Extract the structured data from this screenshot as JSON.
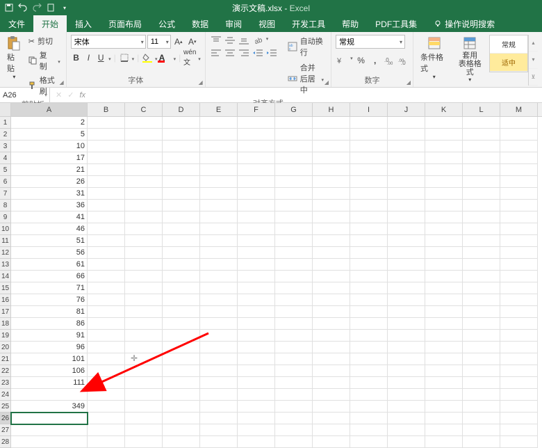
{
  "title": {
    "doc": "演示文稿.xlsx",
    "sep": " - ",
    "app": "Excel"
  },
  "tabs": [
    "文件",
    "开始",
    "插入",
    "页面布局",
    "公式",
    "数据",
    "审阅",
    "视图",
    "开发工具",
    "帮助",
    "PDF工具集"
  ],
  "active_tab": 1,
  "tell_me": "操作说明搜索",
  "clipboard": {
    "paste": "粘贴",
    "cut": "剪切",
    "copy": "复制",
    "format_painter": "格式刷",
    "label": "剪贴板"
  },
  "font": {
    "name": "宋体",
    "size": "11",
    "label": "字体",
    "bold": "B",
    "italic": "I",
    "underline": "U"
  },
  "align": {
    "wrap": "自动换行",
    "merge": "合并后居中",
    "label": "对齐方式"
  },
  "number": {
    "format": "常规",
    "label": "数字"
  },
  "styles": {
    "cond": "条件格式",
    "table": "套用\n表格格式",
    "normal": "常规",
    "good": "适中"
  },
  "namebox": "A26",
  "chart_data": {
    "type": "table",
    "columns": [
      "A"
    ],
    "rows": [
      {
        "r": 1,
        "A": 2
      },
      {
        "r": 2,
        "A": 5
      },
      {
        "r": 3,
        "A": 10
      },
      {
        "r": 4,
        "A": 17
      },
      {
        "r": 5,
        "A": 21
      },
      {
        "r": 6,
        "A": 26
      },
      {
        "r": 7,
        "A": 31
      },
      {
        "r": 8,
        "A": 36
      },
      {
        "r": 9,
        "A": 41
      },
      {
        "r": 10,
        "A": 46
      },
      {
        "r": 11,
        "A": 51
      },
      {
        "r": 12,
        "A": 56
      },
      {
        "r": 13,
        "A": 61
      },
      {
        "r": 14,
        "A": 66
      },
      {
        "r": 15,
        "A": 71
      },
      {
        "r": 16,
        "A": 76
      },
      {
        "r": 17,
        "A": 81
      },
      {
        "r": 18,
        "A": 86
      },
      {
        "r": 19,
        "A": 91
      },
      {
        "r": 20,
        "A": 96
      },
      {
        "r": 21,
        "A": 101
      },
      {
        "r": 22,
        "A": 106
      },
      {
        "r": 23,
        "A": 111
      },
      {
        "r": 24,
        "A": ""
      },
      {
        "r": 25,
        "A": 349
      },
      {
        "r": 26,
        "A": ""
      },
      {
        "r": 27,
        "A": ""
      },
      {
        "r": 28,
        "A": ""
      }
    ]
  },
  "col_letters": [
    "A",
    "B",
    "C",
    "D",
    "E",
    "F",
    "G",
    "H",
    "I",
    "J",
    "K",
    "L",
    "M"
  ],
  "selected_cell": "A26"
}
